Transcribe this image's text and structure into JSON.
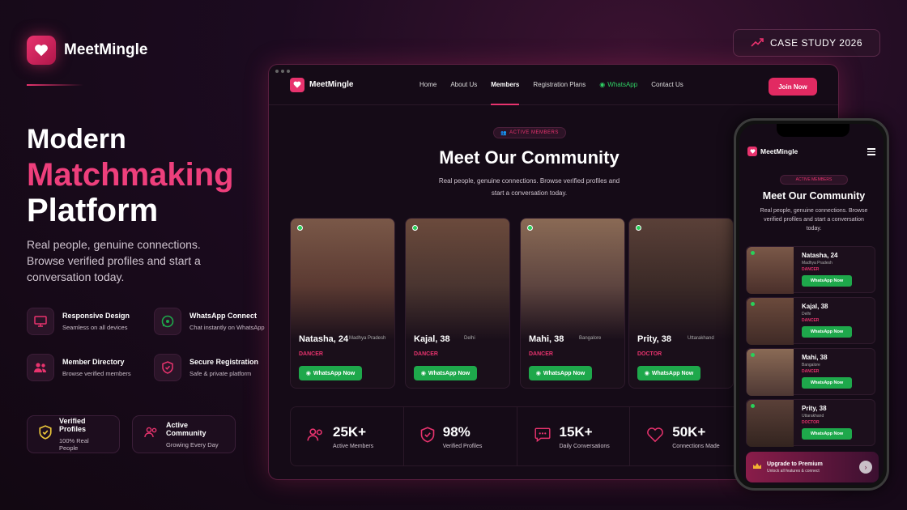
{
  "brand": {
    "name": "MeetMingle",
    "tag": "CASE STUDY 2026"
  },
  "hero": {
    "line1": "Modern",
    "line2": "Matchmaking",
    "line3": "Platform",
    "description": "Real people, genuine connections. Browse verified profiles and start a conversation today."
  },
  "features": [
    {
      "title": "Responsive Design",
      "sub": "Seamless on all devices",
      "icon": "monitor-icon"
    },
    {
      "title": "WhatsApp Connect",
      "sub": "Chat instantly on WhatsApp",
      "icon": "whatsapp-icon"
    },
    {
      "title": "Member Directory",
      "sub": "Browse verified members",
      "icon": "users-icon"
    },
    {
      "title": "Secure Registration",
      "sub": "Safe & private platform",
      "icon": "shield-icon"
    }
  ],
  "badges": [
    {
      "title": "Verified Profiles",
      "sub": "100% Real People",
      "icon": "shield-check-icon"
    },
    {
      "title": "Active Community",
      "sub": "Growing Every Day",
      "icon": "users-icon"
    }
  ],
  "nav": {
    "brand": "MeetMingle",
    "links": [
      "Home",
      "About Us",
      "Members",
      "Registration Plans",
      "WhatsApp",
      "Contact Us"
    ],
    "active": "Members",
    "cta": "Join Now"
  },
  "main": {
    "pill": "ACTIVE MEMBERS",
    "title": "Meet Our Community",
    "subtitle_line1": "Real people, genuine connections. Browse verified profiles and",
    "subtitle_line2": "start a conversation today."
  },
  "members": [
    {
      "name": "Natasha, 24",
      "location": "Madhya Pradesh",
      "job": "DANCER",
      "cta": "WhatsApp Now",
      "tone": "#6b4a3c"
    },
    {
      "name": "Kajal, 38",
      "location": "Delhi",
      "job": "DANCER",
      "cta": "WhatsApp Now",
      "tone": "#5d4035"
    },
    {
      "name": "Mahi, 38",
      "location": "Bangalore",
      "job": "DANCER",
      "cta": "WhatsApp Now",
      "tone": "#6e5648"
    },
    {
      "name": "Prity, 38",
      "location": "Uttarakhand",
      "job": "DOCTOR",
      "cta": "WhatsApp Now",
      "tone": "#4f3a32"
    }
  ],
  "stats": [
    {
      "value": "25K+",
      "label": "Active Members",
      "icon": "users-icon"
    },
    {
      "value": "98%",
      "label": "Verified Profiles",
      "icon": "shield-check-icon"
    },
    {
      "value": "15K+",
      "label": "Daily Conversations",
      "icon": "chat-icon"
    },
    {
      "value": "50K+",
      "label": "Connections Made",
      "icon": "heart-icon"
    }
  ],
  "mobile": {
    "pill": "ACTIVE MEMBERS",
    "title": "Meet Our Community",
    "subtitle": "Real people, genuine connections. Browse verified profiles and start a conversation today.",
    "upgrade_title": "Upgrade to Premium",
    "upgrade_sub": "Unlock all features & connect"
  },
  "colors": {
    "accent": "#e8336e",
    "whatsapp": "#1ea84b",
    "bg": "#150b17"
  }
}
